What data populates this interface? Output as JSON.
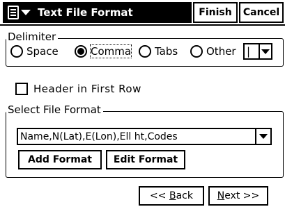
{
  "titlebar": {
    "title": "Text File Format",
    "finish_label": "Finish",
    "cancel_label": "Cancel"
  },
  "delimiter": {
    "legend": "Delimiter",
    "options": [
      {
        "label": "Space",
        "selected": false
      },
      {
        "label": "Comma",
        "selected": true
      },
      {
        "label": "Tabs",
        "selected": false
      },
      {
        "label": "Other",
        "selected": false
      }
    ],
    "other_value": "|"
  },
  "header_checkbox": {
    "label": "Header in First Row",
    "checked": false
  },
  "file_format": {
    "legend": "Select File Format",
    "selected": "Name,N(Lat),E(Lon),Ell ht,Codes",
    "add_label": "Add Format",
    "edit_label": "Edit Format"
  },
  "nav": {
    "back_prefix": "<< ",
    "back_mnemonic": "B",
    "back_rest": "ack",
    "next_mnemonic": "N",
    "next_rest": "ext >>"
  }
}
